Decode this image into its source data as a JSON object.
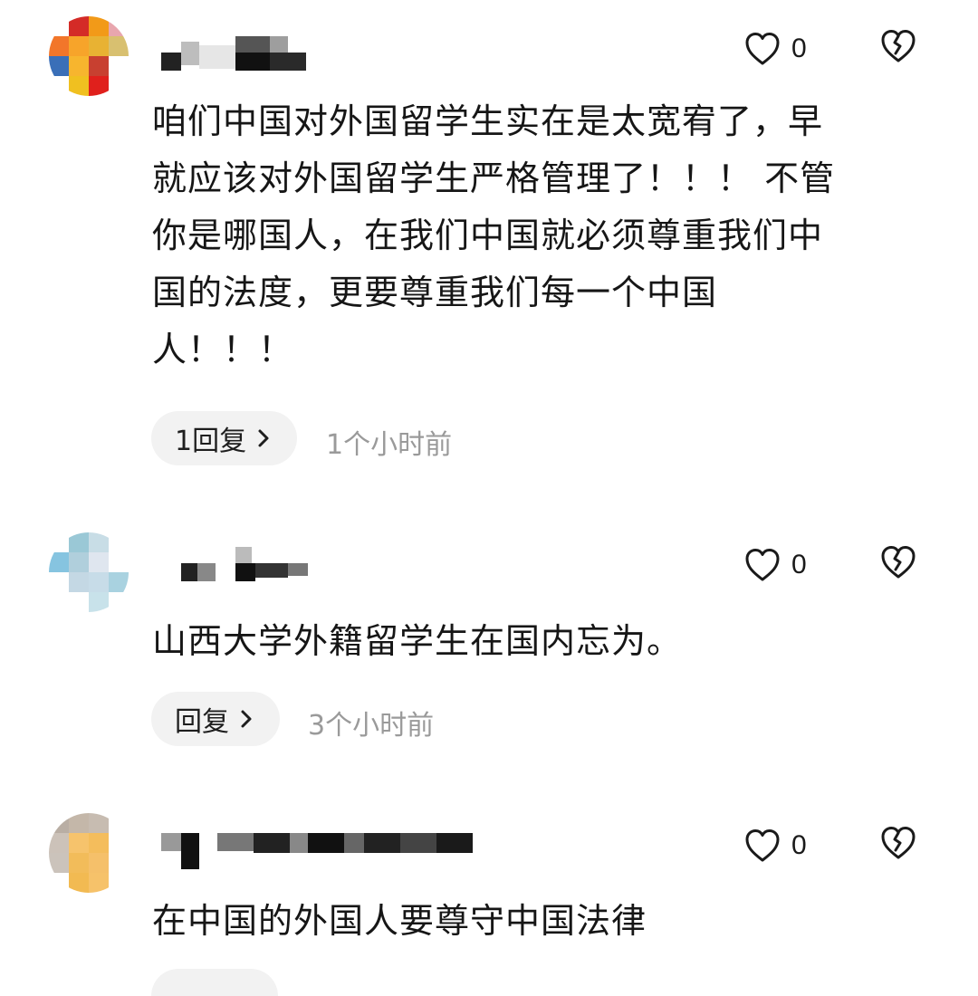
{
  "comments": [
    {
      "avatar_colors": [
        "#ffffff",
        "#d42b27",
        "#f29a18",
        "#e8a6ae",
        "#f2762a",
        "#f7a42a",
        "#e8b233",
        "#d8c070",
        "#3a6fb8",
        "#f7b52e",
        "#c84030",
        "#ffffff",
        "#ffffff",
        "#f0c020",
        "#e0201c",
        "#ffffff"
      ],
      "like_count": "0",
      "text": "咱们中国对外国留学生实在是太宽宥了，早\n就应该对外国留学生严格管理了！！！ 不管\n你是哪国人，在我们中国就必须尊重我们中\n国的法度，更要尊重我们每一个中国\n人！！！",
      "reply_label": "1回复",
      "time": "1个小时前"
    },
    {
      "avatar_colors": [
        "#ffffff",
        "#9ac8d6",
        "#c8dde6",
        "#ffffff",
        "#86c4e0",
        "#b0cfdc",
        "#dfe6ef",
        "#ffffff",
        "#ffffff",
        "#c4d8e4",
        "#c7dce8",
        "#a9d2e0",
        "#ffffff",
        "#ffffff",
        "#c8e2ea",
        "#ffffff"
      ],
      "like_count": "0",
      "text": "山西大学外籍留学生在国内忘为。",
      "reply_label": "回复",
      "time": "3个小时前"
    },
    {
      "avatar_colors": [
        "#b9aea4",
        "#c4b7a9",
        "#c7bcb1",
        "#ffffff",
        "#ccc2b9",
        "#f6c36c",
        "#f4bd5c",
        "#ffffff",
        "#cbc3bb",
        "#f2bc5a",
        "#f5c06a",
        "#ffffff",
        "#ffffff",
        "#f2ba52",
        "#f6c26a",
        "#ffffff"
      ],
      "like_count": "0",
      "text": "在中国的外国人要尊守中国法律"
    }
  ]
}
